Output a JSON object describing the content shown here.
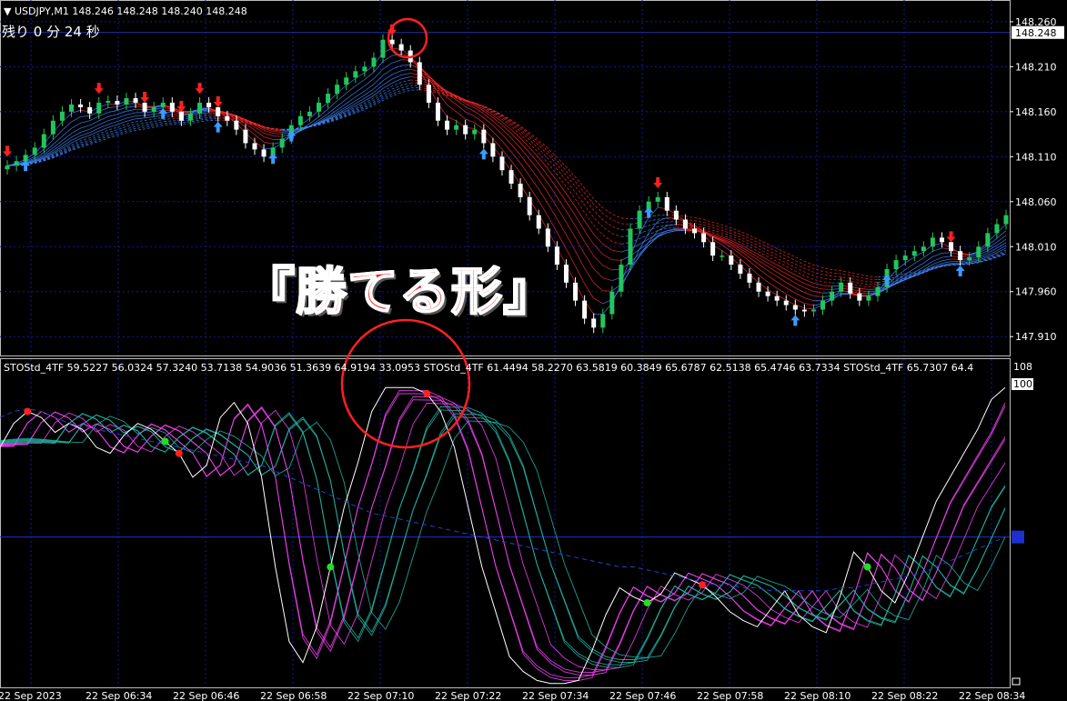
{
  "header": {
    "symbol_label": "USDJPY,M1",
    "ohlc": "148.246 148.248 148.240 148.248",
    "timer_label": "残り 0 分 24 秒"
  },
  "headline": "『勝てる形』",
  "sto_line": "STOStd_4TF 59.5227 56.0324 57.3240 53.7138 54.9036 51.3639 64.9194 33.0953   STOStd_4TF 61.4494 58.2270 63.5819 60.3849 65.6787 62.5138 65.4746 63.7334   STOStd_4TF 65.7307 64.4",
  "colors": {
    "bull_candle": "#22c55e",
    "bear_candle": "#ffffff",
    "up_arrow": "#3b9cff",
    "down_arrow": "#ff2020",
    "ribbon_bear": "#ff2a2a",
    "ribbon_bull": "#4488ff",
    "stoch_magenta": "#ff44ff",
    "stoch_teal": "#22bbaa",
    "grid": "#0b1f99",
    "circle": "#ff2020"
  },
  "chart_data": [
    {
      "type": "candlestick",
      "title": "USDJPY,M1",
      "y_ticks": [
        "148.260",
        "148.210",
        "148.160",
        "148.110",
        "148.060",
        "148.010",
        "147.960",
        "147.910"
      ],
      "current_price": "148.248",
      "ylim": [
        147.89,
        148.27
      ],
      "x_ticks": [
        "22 Sep 2023",
        "22 Sep 06:34",
        "22 Sep 06:46",
        "22 Sep 06:58",
        "22 Sep 07:10",
        "22 Sep 07:22",
        "22 Sep 07:34",
        "22 Sep 07:46",
        "22 Sep 07:58",
        "22 Sep 08:10",
        "22 Sep 08:22",
        "22 Sep 08:34"
      ],
      "close_series": [
        148.1,
        148.105,
        148.112,
        148.12,
        148.135,
        148.15,
        148.16,
        148.168,
        148.165,
        148.158,
        148.17,
        148.172,
        148.168,
        148.175,
        148.17,
        148.16,
        148.165,
        148.17,
        148.16,
        148.15,
        148.158,
        148.17,
        148.165,
        148.155,
        148.15,
        148.14,
        148.125,
        148.118,
        148.11,
        148.12,
        148.13,
        148.145,
        148.155,
        148.16,
        148.17,
        148.18,
        148.19,
        148.198,
        148.205,
        148.21,
        148.22,
        148.24,
        148.235,
        148.228,
        148.215,
        148.19,
        148.17,
        148.15,
        148.14,
        148.145,
        148.135,
        148.14,
        148.125,
        148.11,
        148.095,
        148.08,
        148.065,
        148.045,
        148.03,
        148.01,
        147.99,
        147.97,
        147.95,
        147.93,
        147.92,
        147.935,
        147.96,
        147.99,
        148.03,
        148.05,
        148.06,
        148.065,
        148.05,
        148.04,
        148.03,
        148.025,
        148.015,
        148.0,
        148.0,
        147.99,
        147.98,
        147.97,
        147.96,
        147.955,
        147.95,
        147.945,
        147.94,
        147.938,
        147.94,
        147.95,
        147.96,
        147.97,
        147.958,
        147.95,
        147.955,
        147.965,
        147.985,
        147.995,
        148.0,
        148.005,
        148.01,
        148.02,
        148.015,
        148.005,
        147.995,
        147.998,
        148.01,
        148.025,
        148.035,
        148.045
      ],
      "up_arrows_at_index": [
        2,
        17,
        23,
        29,
        31,
        52,
        70,
        86,
        96,
        104
      ],
      "down_arrows_at_index": [
        0,
        10,
        15,
        19,
        21,
        23,
        42,
        71,
        103
      ]
    },
    {
      "type": "line",
      "title": "STOStd_4TF",
      "y_ticks": [
        "108",
        "100"
      ],
      "ylim": [
        0,
        108
      ],
      "level_line": 50,
      "fast_line": [
        80,
        88,
        92,
        90,
        85,
        88,
        86,
        80,
        78,
        84,
        88,
        86,
        82,
        78,
        70,
        74,
        90,
        95,
        88,
        70,
        40,
        15,
        8,
        20,
        40,
        60,
        75,
        92,
        100,
        100,
        100,
        98,
        92,
        80,
        60,
        40,
        25,
        10,
        5,
        2,
        1,
        1,
        2,
        12,
        24,
        33,
        30,
        28,
        31,
        38,
        36,
        34,
        30,
        25,
        22,
        20,
        26,
        32,
        24,
        20,
        18,
        30,
        45,
        40,
        32,
        28,
        38,
        50,
        62,
        70,
        78,
        86,
        96,
        100
      ],
      "slow_line": [
        90,
        92,
        93,
        92,
        90,
        88,
        87,
        86,
        85,
        84,
        83,
        82,
        81,
        80,
        79,
        78,
        77,
        76,
        75,
        74,
        72,
        70,
        68,
        66,
        64,
        62,
        60,
        58,
        57,
        56,
        55,
        54,
        53,
        52,
        51,
        50,
        49,
        48,
        47,
        46,
        45,
        44,
        43,
        42,
        41,
        40,
        40,
        39,
        38,
        37,
        36,
        35,
        34,
        34,
        33,
        33,
        32,
        32,
        32,
        32,
        32,
        33,
        33,
        34,
        35,
        36,
        37,
        38,
        40,
        42,
        44,
        46,
        48,
        50
      ],
      "red_dots_at_index": [
        2,
        13,
        31,
        51
      ],
      "green_dots_at_index": [
        12,
        24,
        47,
        63
      ]
    }
  ]
}
